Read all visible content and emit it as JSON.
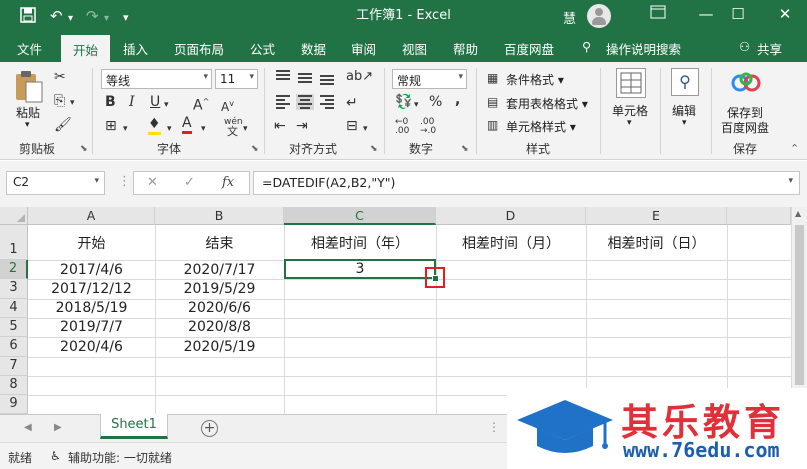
{
  "titlebar": {
    "title": "工作簿1  -  Excel",
    "user": "慧",
    "save_icon": "save-icon",
    "undo_icon": "undo-icon",
    "redo_icon": "redo-icon",
    "customize_icon": "customize-quick-access-icon"
  },
  "tabs": [
    {
      "label": "文件"
    },
    {
      "label": "开始"
    },
    {
      "label": "插入"
    },
    {
      "label": "页面布局"
    },
    {
      "label": "公式"
    },
    {
      "label": "数据"
    },
    {
      "label": "审阅"
    },
    {
      "label": "视图"
    },
    {
      "label": "帮助"
    },
    {
      "label": "百度网盘"
    },
    {
      "label": "操作说明搜索"
    }
  ],
  "share_label": "共享",
  "ribbon": {
    "clipboard": {
      "label": "剪贴板",
      "paste": "粘贴"
    },
    "font": {
      "label": "字体",
      "name": "等线",
      "size": "11",
      "wen": "wén"
    },
    "alignment": {
      "label": "对齐方式"
    },
    "number": {
      "label": "数字",
      "format": "常规",
      "percent": "%",
      "comma": ","
    },
    "styles": {
      "label": "样式",
      "conditional": "条件格式",
      "table": "套用表格格式",
      "cell": "单元格样式"
    },
    "cells": {
      "label": "单元格"
    },
    "editing": {
      "label": "编辑"
    },
    "baidu": {
      "line1": "保存到",
      "line2": "百度网盘",
      "label": "保存"
    }
  },
  "formula_bar": {
    "name_box": "C2",
    "formula": "=DATEDIF(A2,B2,\"Y\")",
    "fx": "fx"
  },
  "columns": [
    "A",
    "B",
    "C",
    "D",
    "E"
  ],
  "rows": [
    "1",
    "2",
    "3",
    "4",
    "5",
    "6",
    "7",
    "8",
    "9"
  ],
  "cells": {
    "a1": "开始",
    "b1": "结束",
    "c1": "相差时间（年）",
    "d1": "相差时间（月）",
    "e1": "相差时间（日）",
    "a2": "2017/4/6",
    "b2": "2020/7/17",
    "c2": "3",
    "a3": "2017/12/12",
    "b3": "2019/5/29",
    "a4": "2018/5/19",
    "b4": "2020/6/6",
    "a5": "2019/7/7",
    "b5": "2020/8/8",
    "a6": "2020/4/6",
    "b6": "2020/5/19"
  },
  "sheet_tab": "Sheet1",
  "status": {
    "ready": "就绪",
    "accessibility": "辅助功能: 一切就绪"
  },
  "watermark": {
    "brand": "其乐教育",
    "url": "www.76edu.com"
  },
  "colors": {
    "excel_green": "#217346",
    "highlight_red": "#e02020"
  }
}
